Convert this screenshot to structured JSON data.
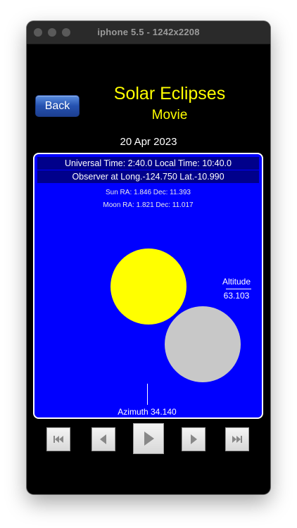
{
  "window": {
    "title": "iphone 5.5 - 1242x2208"
  },
  "nav": {
    "back_label": "Back"
  },
  "header": {
    "title": "Solar Eclipses",
    "subtitle": "Movie",
    "date": "20 Apr 2023"
  },
  "sky": {
    "time_line": "Universal Time: 2:40.0 Local Time: 10:40.0",
    "observer_line": "Observer at  Long.-124.750 Lat.-10.990",
    "sun_coords": "Sun RA:  1.846 Dec: 11.393",
    "moon_coords": "Moon RA: 1.821 Dec: 11.017",
    "altitude_label": "Altitude",
    "altitude_value": "63.103",
    "azimuth_label": "Azimuth  34.140",
    "colors": {
      "sky": "#0000ff",
      "sun": "#ffff00",
      "moon": "#c8c8c8",
      "text_accent": "#ffff00"
    }
  },
  "controls": {
    "first_icon": "skip-to-start-icon",
    "prev_icon": "step-back-icon",
    "play_icon": "play-icon",
    "next_icon": "step-forward-icon",
    "last_icon": "skip-to-end-icon"
  }
}
